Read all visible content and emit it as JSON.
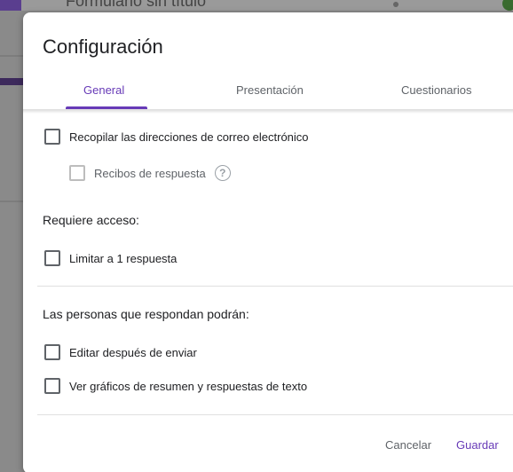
{
  "background": {
    "form_title": "Formulario sin título"
  },
  "dialog": {
    "title": "Configuración",
    "tabs": [
      {
        "label": "General",
        "active": true
      },
      {
        "label": "Presentación",
        "active": false
      },
      {
        "label": "Cuestionarios",
        "active": false
      }
    ],
    "general": {
      "collect_emails": {
        "label": "Recopilar las direcciones de correo electrónico",
        "checked": false
      },
      "response_receipts": {
        "label": "Recibos de respuesta",
        "checked": false,
        "disabled": true
      },
      "requires_access_heading": "Requiere acceso:",
      "limit_one": {
        "label": "Limitar a 1 respuesta",
        "checked": false
      },
      "respondents_heading": "Las personas que respondan podrán:",
      "edit_after": {
        "label": "Editar después de enviar",
        "checked": false
      },
      "see_summary": {
        "label": "Ver gráficos de resumen y respuestas de texto",
        "checked": false
      }
    },
    "buttons": {
      "cancel": "Cancelar",
      "save": "Guardar"
    }
  },
  "icons": {
    "help": "help-circle-icon"
  },
  "colors": {
    "accent": "#673ab7",
    "text": "#202124",
    "muted": "#5f6368"
  }
}
